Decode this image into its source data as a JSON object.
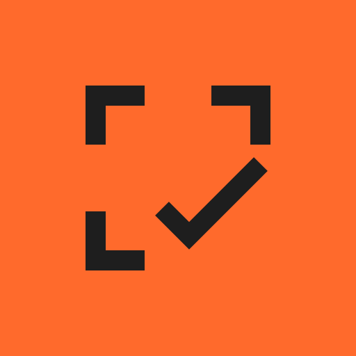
{
  "app_icon": {
    "icon_name": "scan-check-icon",
    "colors": {
      "background": "#FF6A2C",
      "foreground": "#1E1E1E"
    },
    "parts": {
      "frame": "corner-frame",
      "mark": "checkmark"
    }
  }
}
